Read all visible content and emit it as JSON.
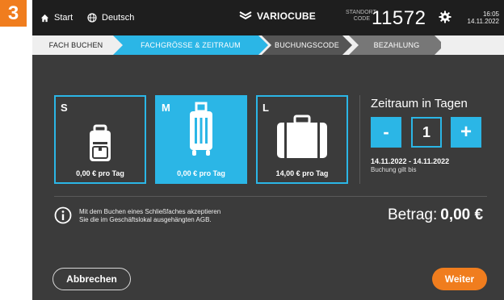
{
  "step_badge": "3",
  "colors": {
    "accent": "#2bb6e6",
    "orange": "#f07d1e",
    "background": "#3b3b3b",
    "topbar": "#1e1e1e"
  },
  "topbar": {
    "start_label": "Start",
    "start_icon": "home-icon",
    "language_label": "Deutsch",
    "language_icon": "globe-icon",
    "brand": "VARIOCUBE",
    "brand_icon": "variocube-logo",
    "location_label_line1": "STANDORT",
    "location_label_line2": "CODE",
    "location_code": "11572",
    "settings_icon": "gear-icon",
    "time": "16:05",
    "date": "14.11.2022"
  },
  "steps": [
    {
      "label": "FACH BUCHEN",
      "state": "done"
    },
    {
      "label": "FACHGRÖSSE & ZEITRAUM",
      "state": "active"
    },
    {
      "label": "BUCHUNGSCODE",
      "state": "pending"
    },
    {
      "label": "BEZAHLUNG",
      "state": "pending"
    }
  ],
  "sizes": [
    {
      "size": "S",
      "icon": "backpack-icon",
      "price": "0,00 € pro Tag",
      "selected": false
    },
    {
      "size": "M",
      "icon": "trolley-suitcase-icon",
      "price": "0,00 € pro Tag",
      "selected": true
    },
    {
      "size": "L",
      "icon": "briefcase-icon",
      "price": "14,00 € pro Tag",
      "selected": false
    }
  ],
  "period": {
    "title": "Zeitraum in Tagen",
    "minus_label": "-",
    "days": "1",
    "plus_label": "+",
    "date_range": "14.11.2022 - 14.11.2022",
    "valid_text": "Buchung gilt bis"
  },
  "terms": {
    "icon": "info-icon",
    "line1": "Mit dem Buchen eines Schließfaches akzeptieren",
    "line2": "Sie die im Geschäftslokal ausgehängten AGB."
  },
  "amount": {
    "label": "Betrag:",
    "value": "0,00 €"
  },
  "buttons": {
    "cancel": "Abbrechen",
    "next": "Weiter"
  }
}
